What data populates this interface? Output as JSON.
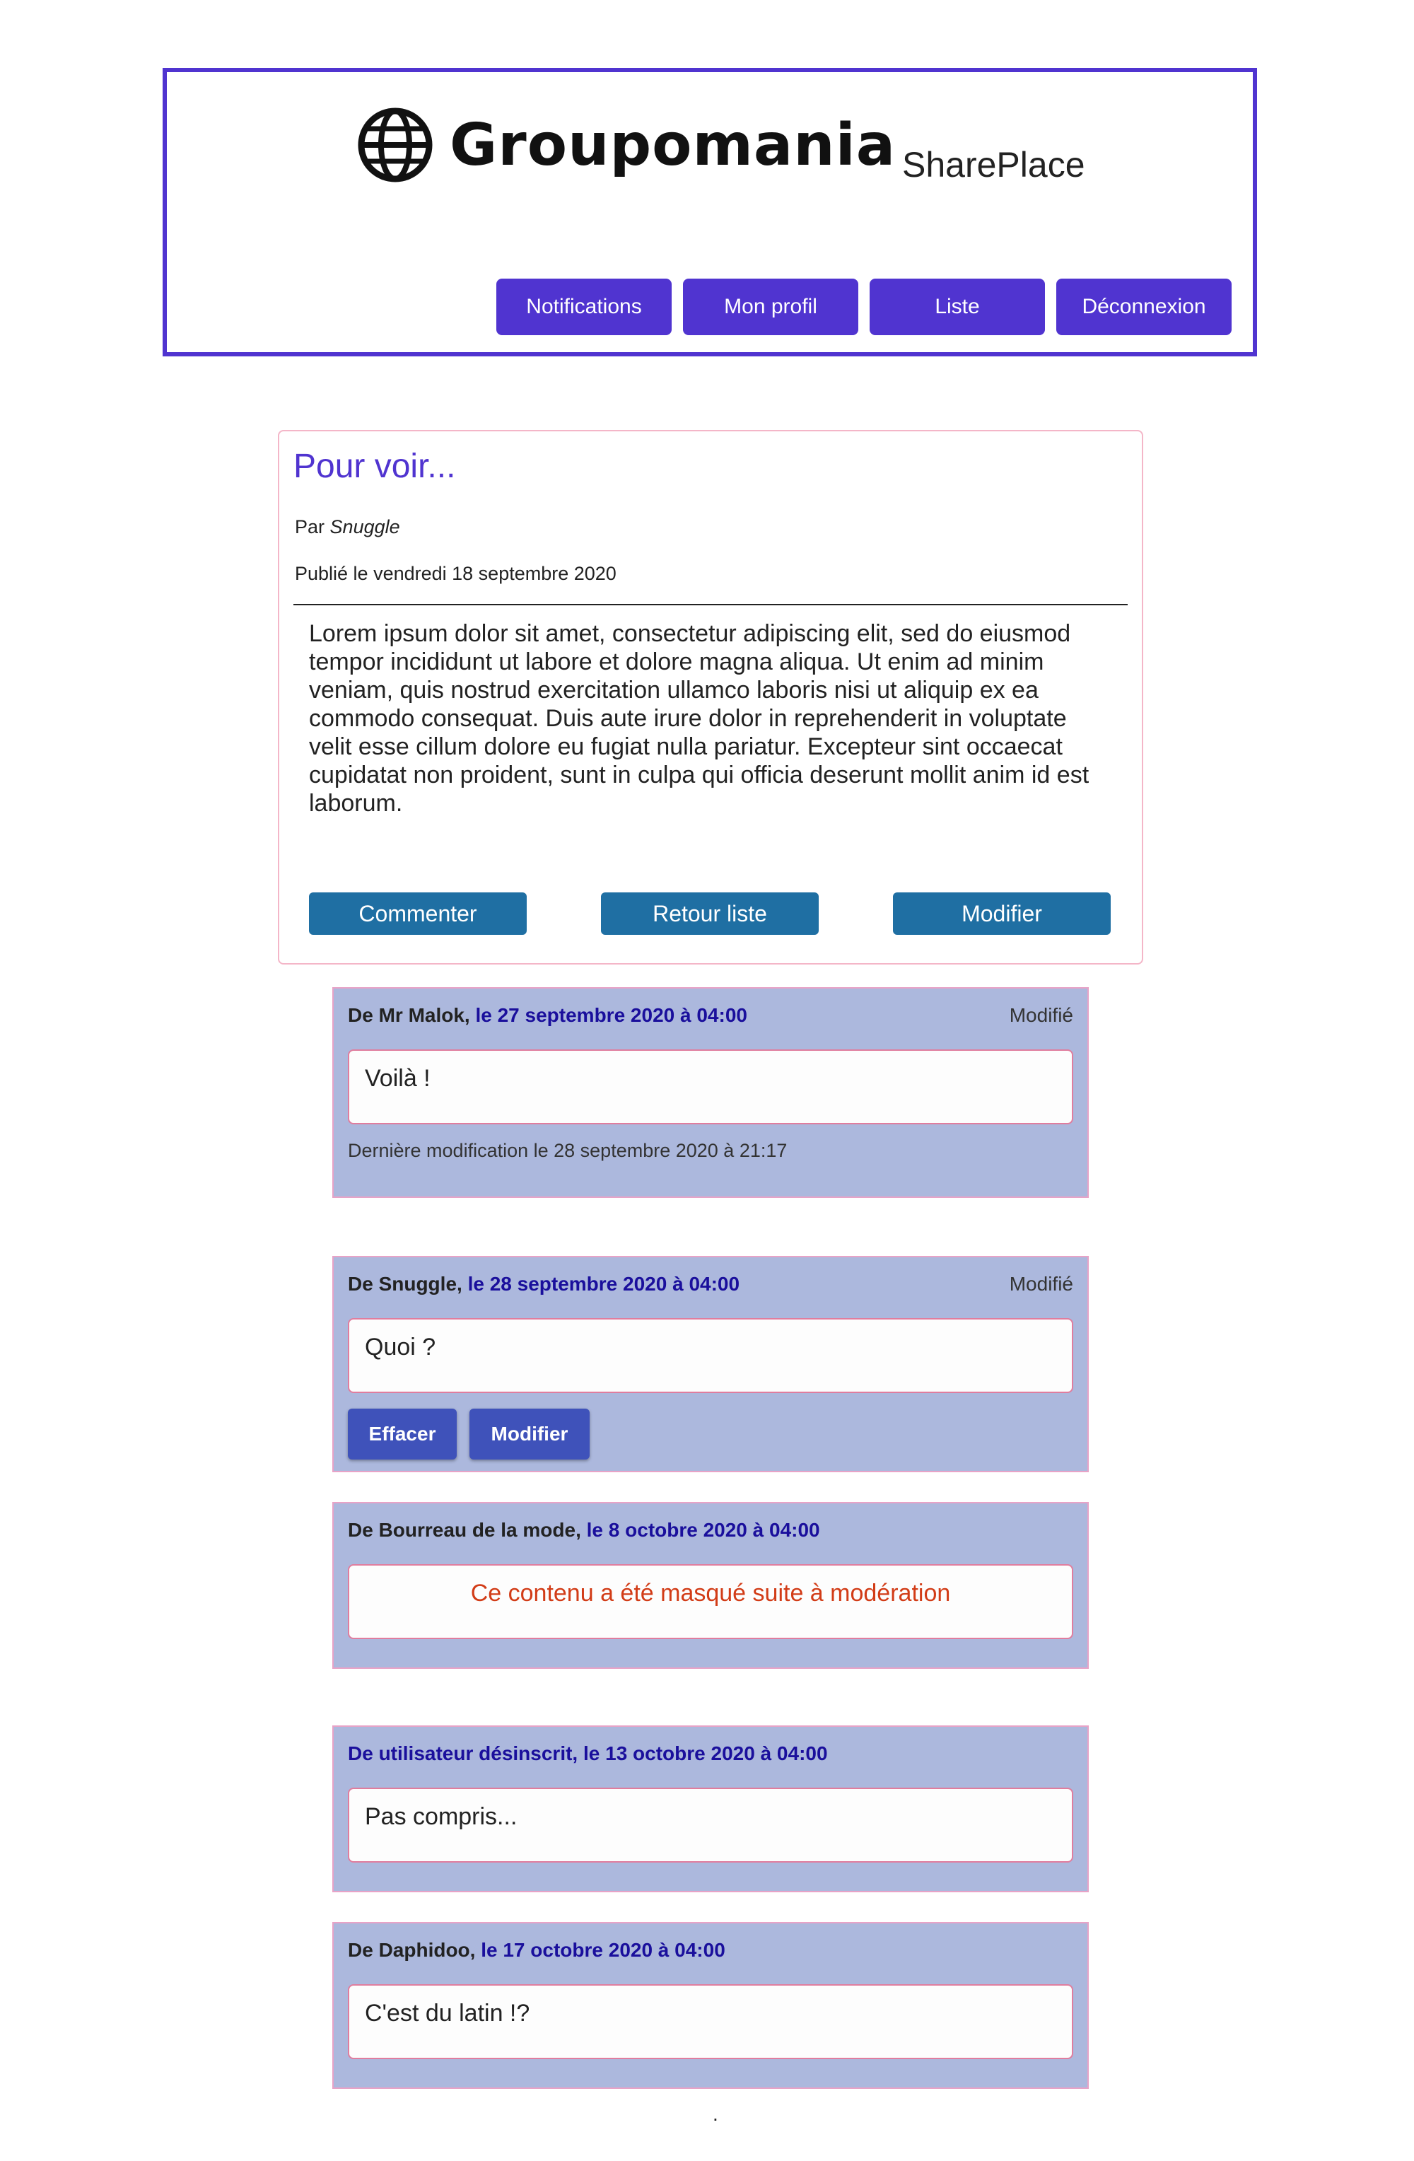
{
  "header": {
    "logo_text": "Groupomania",
    "app_name": "SharePlace",
    "nav": [
      "Notifications",
      "Mon profil",
      "Liste",
      "Déconnexion"
    ]
  },
  "post": {
    "title": "Pour voir...",
    "author_prefix": "Par",
    "author": "Snuggle",
    "date": "Publié le vendredi 18 septembre 2020",
    "body": "Lorem ipsum dolor sit amet, consectetur adipiscing elit, sed do eiusmod tempor incididunt ut labore et dolore magna aliqua. Ut enim ad minim veniam, quis nostrud exercitation ullamco laboris nisi ut aliquip ex ea commodo consequat. Duis aute irure dolor in reprehenderit in voluptate velit esse cillum dolore eu fugiat nulla pariatur. Excepteur sint occaecat cupidatat non proident, sunt in culpa qui officia deserunt mollit anim id est laborum.",
    "buttons": [
      "Commenter",
      "Retour liste",
      "Modifier"
    ]
  },
  "comments": [
    {
      "author": "De Mr Malok,",
      "date": " le 27 septembre 2020 à 04:00",
      "edited": "Modifié",
      "text": "Voilà !",
      "last_edit": "Dernière modification le 28 septembre 2020 à 21:17"
    },
    {
      "author": "De Snuggle,",
      "date": " le 28 septembre 2020 à 04:00",
      "edited": "Modifié",
      "text": "Quoi ?",
      "buttons": [
        "Effacer",
        "Modifier"
      ]
    },
    {
      "author": "De Bourreau de la mode,",
      "date": " le 8 octobre 2020 à 04:00",
      "text": "Ce contenu a été masqué suite à modération"
    },
    {
      "author": "De utilisateur désinscrit,",
      "date": " le 13 octobre 2020 à 04:00",
      "text": "Pas compris..."
    },
    {
      "author": "De Daphidoo,",
      "date": " le 17 octobre 2020 à 04:00",
      "text": "C'est du latin !?"
    }
  ],
  "footer": {
    "dot": "."
  },
  "colors": {
    "brand": "#5034d0",
    "post_button": "#1f6fa3",
    "comment_bg": "#acb8dd",
    "comment_button": "#3f52ba",
    "moderation_text": "#d23c17"
  }
}
